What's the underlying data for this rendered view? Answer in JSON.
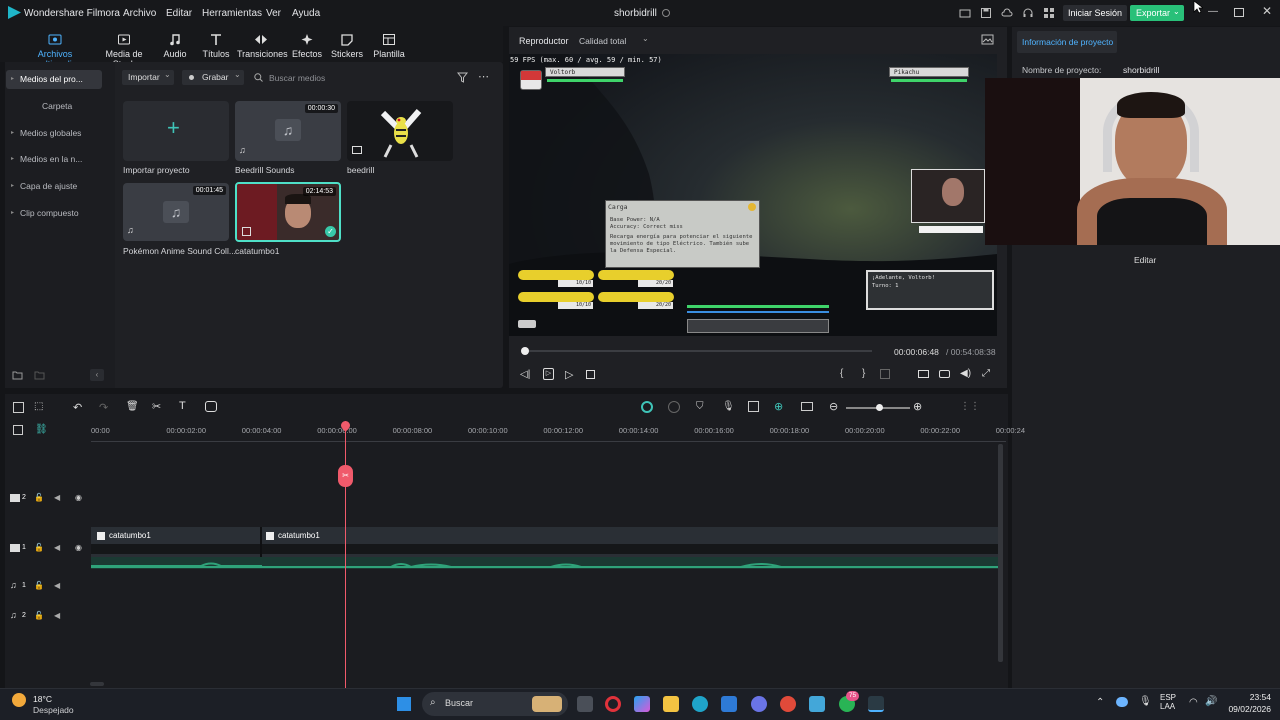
{
  "app": {
    "name": "Wondershare Filmora",
    "project_title": "shorbidrill",
    "menu": [
      "Archivo",
      "Editar",
      "Herramientas",
      "Ver",
      "Ayuda"
    ],
    "login_label": "Iniciar Sesión",
    "export_label": "Exportar"
  },
  "top_tabs": [
    "Archivos multimedia",
    "Media de Stock",
    "Audio",
    "Títulos",
    "Transiciones",
    "Efectos",
    "Stickers",
    "Plantilla"
  ],
  "sidebar": {
    "items": [
      "Medios del pro...",
      "Carpeta",
      "Medios globales",
      "Medios en la n...",
      "Capa de ajuste",
      "Clip compuesto"
    ]
  },
  "media_toolbar": {
    "import_label": "Importar",
    "record_label": "Grabar",
    "search_placeholder": "Buscar medios"
  },
  "media_items": [
    {
      "label": "Importar proyecto",
      "duration": ""
    },
    {
      "label": "Beedrill Sounds",
      "duration": "00:00:30"
    },
    {
      "label": "beedrill",
      "duration": ""
    },
    {
      "label": "Pokémon Anime Sound Coll...",
      "duration": "00:01:45"
    },
    {
      "label": "catatumbo1",
      "duration": "02:14:53"
    }
  ],
  "player": {
    "tab_label": "Reproductor",
    "quality_label": "Calidad total",
    "current_time": "00:00:06:48",
    "total_time": "/ 00:54:08:38",
    "fps_text": "59 FPS (max. 60 / avg. 59 / min. 57)",
    "progress": 0.0
  },
  "video_overlay": {
    "enemy_name": "Voltorb",
    "player_mon": "Pikachu",
    "move_title": "Carga",
    "move_line1": "Base Power: N/A",
    "move_line2": "Accuracy: Correct miss",
    "move_desc": "Recarga energía para potenciar el siguiente movimiento de tipo Eléctrico. También sube la Defensa Especial.",
    "hp1": "10/10",
    "hp2": "20/20",
    "hp3": "10/10",
    "hp4": "20/20",
    "msg_line1": "¡Adelante, Voltorb!",
    "msg_line2": "Turno: 1"
  },
  "project_info": {
    "header": "Información de proyecto",
    "name_label": "Nombre de proyecto:",
    "name_value": "shorbidrill",
    "edit_label": "Editar"
  },
  "timeline": {
    "ruler": [
      "00:00",
      "00:00:02:00",
      "00:00:04:00",
      "00:00:06:00",
      "00:00:08:00",
      "00:00:10:00",
      "00:00:12:00",
      "00:00:14:00",
      "00:00:16:00",
      "00:00:18:00",
      "00:00:20:00",
      "00:00:22:00",
      "00:00:24"
    ],
    "tracks": [
      "2",
      "1",
      "1",
      "2"
    ],
    "clip_label_a": "catatumbo1",
    "clip_label_b": "catatumbo1",
    "playhead_fraction": 0.33
  },
  "taskbar": {
    "temp": "18°C",
    "weather": "Despejado",
    "search_placeholder": "Buscar",
    "lang1": "ESP",
    "lang2": "LAA",
    "time": "23:54",
    "date": "09/02/2026",
    "badge": "75"
  },
  "colors": {
    "accent": "#1f7fd1",
    "export_green": "#29c079",
    "playhead": "#f05a6b",
    "audio_wave": "#2fa37a"
  }
}
